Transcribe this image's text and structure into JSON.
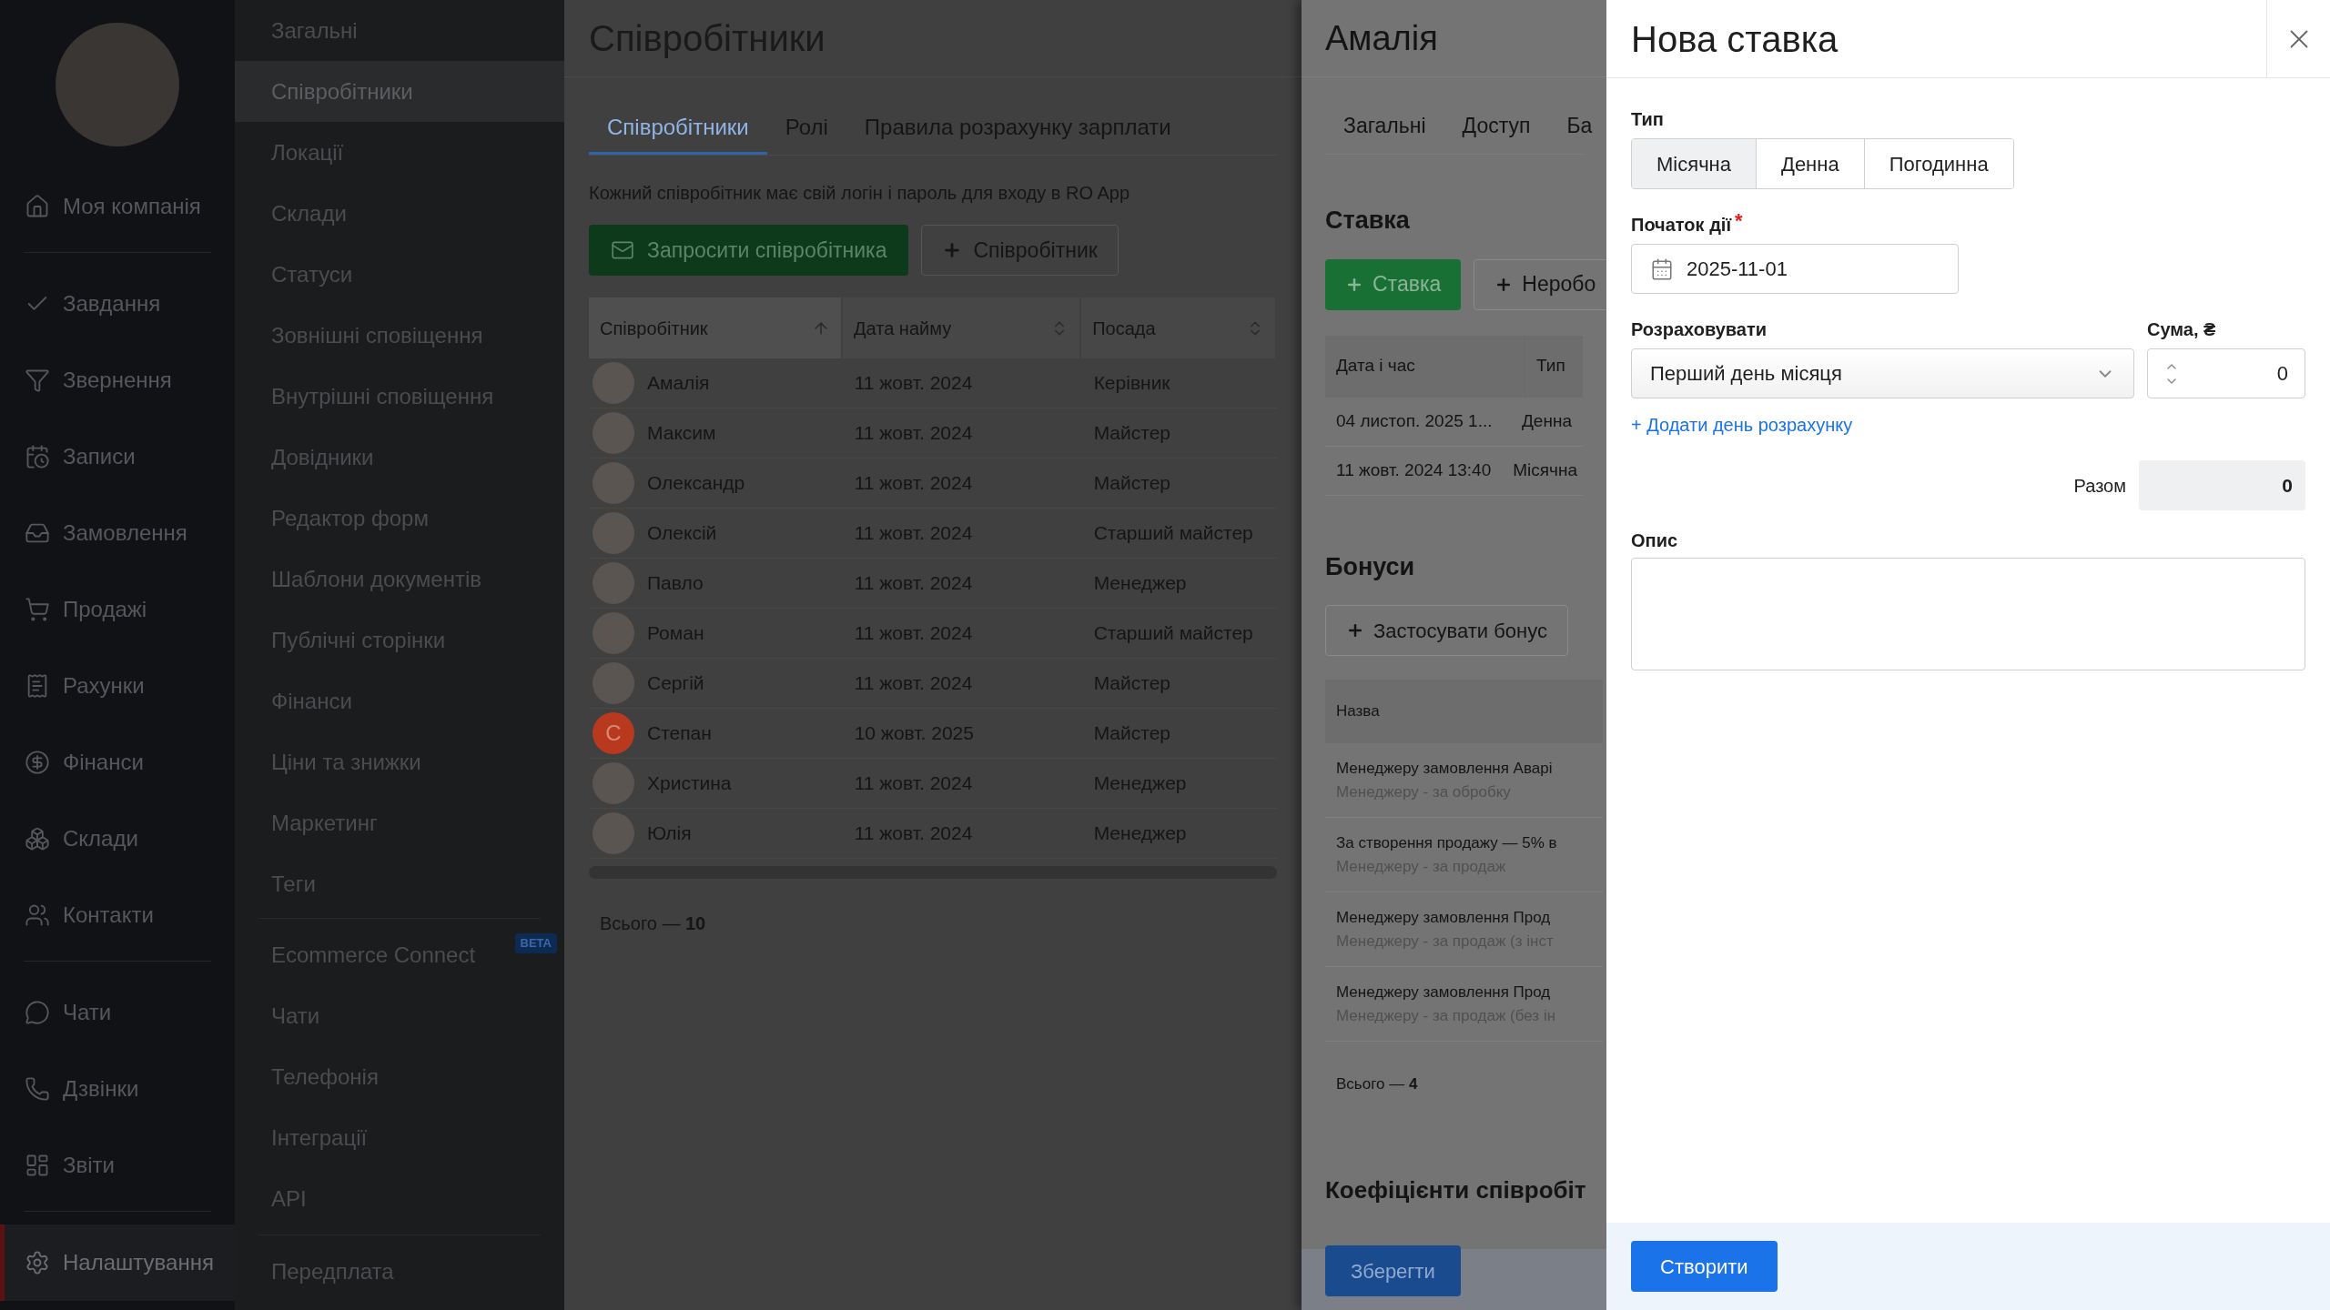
{
  "nav": {
    "groups": [
      [
        {
          "label": "Моя компанія",
          "selected": false
        }
      ],
      [
        {
          "label": "Завдання",
          "selected": false
        },
        {
          "label": "Звернення",
          "selected": false
        },
        {
          "label": "Записи",
          "selected": false
        },
        {
          "label": "Замовлення",
          "selected": false
        },
        {
          "label": "Продажі",
          "selected": false
        },
        {
          "label": "Рахунки",
          "selected": false
        },
        {
          "label": "Фінанси",
          "selected": false
        },
        {
          "label": "Склади",
          "selected": false
        },
        {
          "label": "Контакти",
          "selected": false
        }
      ],
      [
        {
          "label": "Чати",
          "selected": false
        },
        {
          "label": "Дзвінки",
          "selected": false
        },
        {
          "label": "Звіти",
          "selected": false
        }
      ],
      [
        {
          "label": "Налаштування",
          "selected": true
        }
      ]
    ]
  },
  "settings_menu": {
    "groups": [
      [
        {
          "label": "Загальні",
          "selected": false
        },
        {
          "label": "Співробітники",
          "selected": true
        },
        {
          "label": "Локації",
          "selected": false
        },
        {
          "label": "Склади",
          "selected": false
        },
        {
          "label": "Статуси",
          "selected": false
        },
        {
          "label": "Зовнішні сповіщення",
          "selected": false
        },
        {
          "label": "Внутрішні сповіщення",
          "selected": false
        },
        {
          "label": "Довідники",
          "selected": false
        },
        {
          "label": "Редактор форм",
          "selected": false
        },
        {
          "label": "Шаблони документів",
          "selected": false
        },
        {
          "label": "Публічні сторінки",
          "selected": false
        },
        {
          "label": "Фінанси",
          "selected": false
        },
        {
          "label": "Ціни та знижки",
          "selected": false
        },
        {
          "label": "Маркетинг",
          "selected": false
        },
        {
          "label": "Теги",
          "selected": false
        }
      ],
      [
        {
          "label": "Ecommerce Connect",
          "selected": false,
          "badge": "BETA"
        },
        {
          "label": "Чати",
          "selected": false
        },
        {
          "label": "Телефонія",
          "selected": false
        },
        {
          "label": "Інтеграції",
          "selected": false
        },
        {
          "label": "API",
          "selected": false
        }
      ],
      [
        {
          "label": "Передплата",
          "selected": false
        }
      ]
    ]
  },
  "main": {
    "title": "Співробітники",
    "tabs": [
      {
        "label": "Співробітники",
        "selected": true
      },
      {
        "label": "Ролі",
        "selected": false
      },
      {
        "label": "Правила розрахунку зарплати",
        "selected": false
      }
    ],
    "description": "Кожний співробітник має свій логін і пароль для входу в RO App",
    "buttons": [
      {
        "label": "Запросити співробітника",
        "kind": "primary"
      },
      {
        "label": "Співробітник",
        "kind": "add"
      }
    ],
    "table": {
      "columns": [
        {
          "label": "Співробітник",
          "sorted": true
        },
        {
          "label": "Дата найму",
          "sorted": false
        },
        {
          "label": "Посада",
          "sorted": false
        }
      ],
      "rows": [
        {
          "kind": "photo",
          "name": "Амалія",
          "hired": "11 жовт. 2024",
          "position": "Керівник"
        },
        {
          "kind": "photo",
          "name": "Максим",
          "hired": "11 жовт. 2024",
          "position": "Майстер"
        },
        {
          "kind": "photo",
          "name": "Олександр",
          "hired": "11 жовт. 2024",
          "position": "Майстер"
        },
        {
          "kind": "photo",
          "name": "Олексій",
          "hired": "11 жовт. 2024",
          "position": "Старший майстер"
        },
        {
          "kind": "photo",
          "name": "Павло",
          "hired": "11 жовт. 2024",
          "position": "Менеджер"
        },
        {
          "kind": "photo",
          "name": "Роман",
          "hired": "11 жовт. 2024",
          "position": "Старший майстер"
        },
        {
          "kind": "photo",
          "name": "Сергій",
          "hired": "11 жовт. 2024",
          "position": "Майстер"
        },
        {
          "kind": "letter",
          "initial": "С",
          "color": "#b8391e",
          "name": "Степан",
          "hired": "10 жовт. 2025",
          "position": "Майстер"
        },
        {
          "kind": "photo",
          "name": "Христина",
          "hired": "11 жовт. 2024",
          "position": "Менеджер"
        },
        {
          "kind": "photo",
          "name": "Юлія",
          "hired": "11 жовт. 2024",
          "position": "Менеджер"
        }
      ]
    },
    "total": "Всього — **10**"
  },
  "employee_panel": {
    "title": "Амалія",
    "tabs": [
      {
        "label": "Загальні",
        "selected": false
      },
      {
        "label": "Доступ",
        "selected": false
      },
      {
        "label": "Ба",
        "selected": false
      }
    ],
    "rate_heading": "Ставка",
    "rate_buttons": [
      {
        "label": "Ставка",
        "kind": "primary"
      },
      {
        "label": "Неробо",
        "kind": "outline"
      }
    ],
    "rate_table": {
      "columns": [
        "Дата і час",
        "Тип"
      ],
      "rows": [
        [
          "04 листоп. 2025 1...",
          "Денна"
        ],
        [
          "11 жовт. 2024 13:40",
          "Місячна"
        ]
      ]
    },
    "bonus_heading": "Бонуси",
    "bonus_button": "Застосувати бонус",
    "bonus_table": {
      "column": "Назва",
      "rows": [
        {
          "title": "Менеджеру замовлення Аварі",
          "subtitle": "Менеджеру - за обробку"
        },
        {
          "title": "За створення продажу — 5% в",
          "subtitle": "Менеджеру - за продаж"
        },
        {
          "title": "Менеджеру замовлення Прод",
          "subtitle": "Менеджеру - за продаж (з інст"
        },
        {
          "title": "Менеджеру замовлення Прод",
          "subtitle": "Менеджеру - за продаж (без ін"
        }
      ]
    },
    "bonus_total": "Всього — **4**",
    "coef_heading": "Коефіцієнти співробіт",
    "save_button": "Зберегти"
  },
  "new_rate": {
    "title": "Нова ставка",
    "type_label": "Тип",
    "types": [
      {
        "label": "Місячна",
        "selected": true
      },
      {
        "label": "Денна",
        "selected": false
      },
      {
        "label": "Погодинна",
        "selected": false
      }
    ],
    "start_label": "Початок дії",
    "required_mark": "*",
    "start_value": "2025-11-01",
    "calc_label": "Розраховувати",
    "calc_value": "Перший день місяця",
    "sum_label": "Сума, ₴",
    "sum_value": "0",
    "add_link": "+ Додати день розрахунку",
    "total_label": "Разом",
    "total_value": "0",
    "desc_label": "Опис",
    "create_button": "Створити"
  }
}
